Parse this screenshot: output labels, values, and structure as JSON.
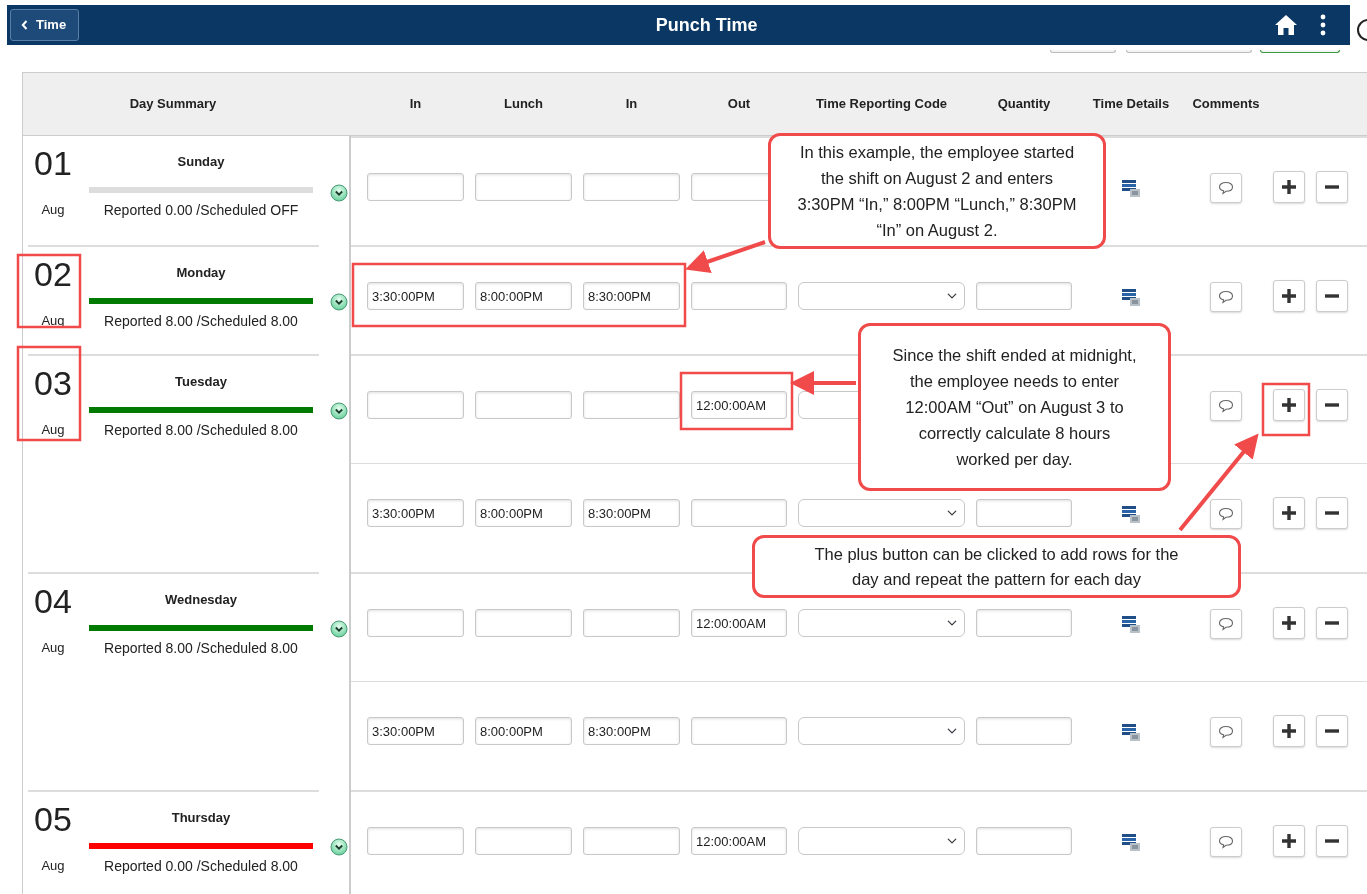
{
  "header": {
    "back_button": "Time",
    "title": "Punch Time"
  },
  "columns": [
    "Day Summary",
    "In",
    "Lunch",
    "In",
    "Out",
    "Time Reporting Code",
    "Quantity",
    "Time Details",
    "Comments"
  ],
  "days": [
    {
      "day": "01",
      "month": "Aug",
      "weekday": "Sunday",
      "color": "#dddddd",
      "summary": "Reported 0.00 /Scheduled OFF",
      "rows": [
        {
          "fields": [
            {
              "kind": "time"
            },
            {
              "kind": "time"
            },
            {
              "kind": "time"
            },
            {
              "kind": "time"
            }
          ],
          "actions": [
            {
              "kind": "details"
            },
            {
              "kind": "comment"
            },
            {
              "kind": "add"
            },
            {
              "kind": "remove"
            }
          ]
        }
      ]
    },
    {
      "day": "02",
      "month": "Aug",
      "weekday": "Monday",
      "color": "#007a00",
      "summary": "Reported 8.00 /Scheduled 8.00",
      "rows": [
        {
          "fields": [
            {
              "kind": "time",
              "value": "3:30:00PM"
            },
            {
              "kind": "time",
              "value": "8:00:00PM"
            },
            {
              "kind": "time",
              "value": "8:30:00PM"
            },
            {
              "kind": "time"
            },
            {
              "kind": "select"
            },
            {
              "kind": "number"
            }
          ],
          "actions": [
            {
              "kind": "details"
            },
            {
              "kind": "comment"
            },
            {
              "kind": "add"
            },
            {
              "kind": "remove"
            }
          ]
        }
      ]
    },
    {
      "day": "03",
      "month": "Aug",
      "weekday": "Tuesday",
      "color": "#007a00",
      "summary": "Reported 8.00 /Scheduled 8.00",
      "rows": [
        {
          "fields": [
            {
              "kind": "time"
            },
            {
              "kind": "time"
            },
            {
              "kind": "time"
            },
            {
              "kind": "time",
              "value": "12:00:00AM"
            },
            {
              "kind": "select"
            }
          ],
          "actions": [
            {
              "kind": "comment"
            },
            {
              "kind": "add"
            },
            {
              "kind": "remove"
            }
          ]
        },
        {
          "fields": [
            {
              "kind": "time",
              "value": "3:30:00PM"
            },
            {
              "kind": "time",
              "value": "8:00:00PM"
            },
            {
              "kind": "time",
              "value": "8:30:00PM"
            },
            {
              "kind": "time"
            },
            {
              "kind": "select"
            },
            {
              "kind": "number"
            }
          ],
          "actions": [
            {
              "kind": "details"
            },
            {
              "kind": "comment"
            },
            {
              "kind": "add"
            },
            {
              "kind": "remove"
            }
          ]
        }
      ]
    },
    {
      "day": "04",
      "month": "Aug",
      "weekday": "Wednesday",
      "color": "#007a00",
      "summary": "Reported 8.00 /Scheduled 8.00",
      "rows": [
        {
          "fields": [
            {
              "kind": "time"
            },
            {
              "kind": "time"
            },
            {
              "kind": "time"
            },
            {
              "kind": "time",
              "value": "12:00:00AM"
            },
            {
              "kind": "select"
            },
            {
              "kind": "number"
            }
          ],
          "actions": [
            {
              "kind": "details"
            },
            {
              "kind": "comment"
            },
            {
              "kind": "add"
            },
            {
              "kind": "remove"
            }
          ]
        },
        {
          "fields": [
            {
              "kind": "time",
              "value": "3:30:00PM"
            },
            {
              "kind": "time",
              "value": "8:00:00PM"
            },
            {
              "kind": "time",
              "value": "8:30:00PM"
            },
            {
              "kind": "time"
            },
            {
              "kind": "select"
            },
            {
              "kind": "number"
            }
          ],
          "actions": [
            {
              "kind": "details"
            },
            {
              "kind": "comment"
            },
            {
              "kind": "add"
            },
            {
              "kind": "remove"
            }
          ]
        }
      ]
    },
    {
      "day": "05",
      "month": "Aug",
      "weekday": "Thursday",
      "color": "#ff0000",
      "summary": "Reported 0.00 /Scheduled 8.00",
      "rows": [
        {
          "fields": [
            {
              "kind": "time"
            },
            {
              "kind": "time"
            },
            {
              "kind": "time"
            },
            {
              "kind": "time",
              "value": "12:00:00AM"
            },
            {
              "kind": "select"
            },
            {
              "kind": "number"
            }
          ],
          "actions": [
            {
              "kind": "details"
            },
            {
              "kind": "comment"
            },
            {
              "kind": "add"
            },
            {
              "kind": "remove"
            }
          ]
        }
      ]
    }
  ],
  "callouts": [
    {
      "text": "In this example, the employee started the shift on August 2 and enters 3:30PM “In,” 8:00PM “Lunch,” 8:30PM “In” on August 2."
    },
    {
      "text": "Since the shift ended at midnight, the employee needs to enter 12:00AM “Out” on August 3 to correctly calculate 8 hours worked per day."
    },
    {
      "text": "The plus button can be clicked to add rows for the day and repeat the pattern for each day"
    }
  ]
}
